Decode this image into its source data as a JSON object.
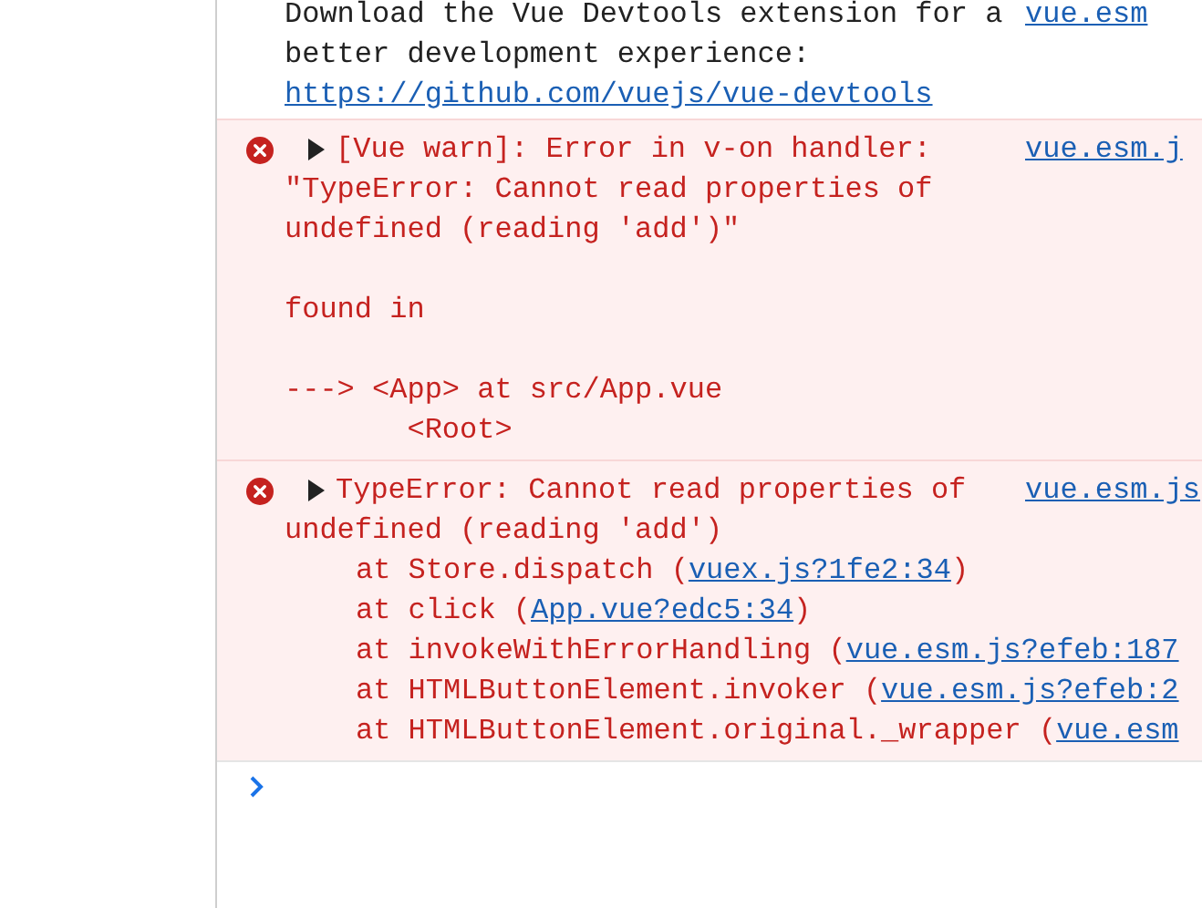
{
  "messages": [
    {
      "kind": "info",
      "text": "Download the Vue Devtools extension for a\nbetter development experience:",
      "link": "https://github.com/vuejs/vue-devtools",
      "source": "vue.esm"
    },
    {
      "kind": "error",
      "expanded": false,
      "headline": "[Vue warn]: Error in v-on handler:",
      "text": "\"TypeError: Cannot read properties of\nundefined (reading 'add')\"\n\nfound in\n\n---> <App> at src/App.vue\n       <Root>",
      "source": "vue.esm.j"
    },
    {
      "kind": "error",
      "expanded": false,
      "headline": "TypeError: Cannot read properties of",
      "text": "undefined (reading 'add')",
      "source": "vue.esm.js",
      "stack": [
        {
          "prefix": "at Store.dispatch (",
          "link": "vuex.js?1fe2:34",
          "suffix": ")"
        },
        {
          "prefix": "at click (",
          "link": "App.vue?edc5:34",
          "suffix": ")"
        },
        {
          "prefix": "at invokeWithErrorHandling (",
          "link": "vue.esm.js?efeb:187"
        },
        {
          "prefix": "at HTMLButtonElement.invoker (",
          "link": "vue.esm.js?efeb:2"
        },
        {
          "prefix": "at HTMLButtonElement.original._wrapper (",
          "link": "vue.esm"
        }
      ]
    }
  ],
  "prompt": {
    "active": true
  }
}
